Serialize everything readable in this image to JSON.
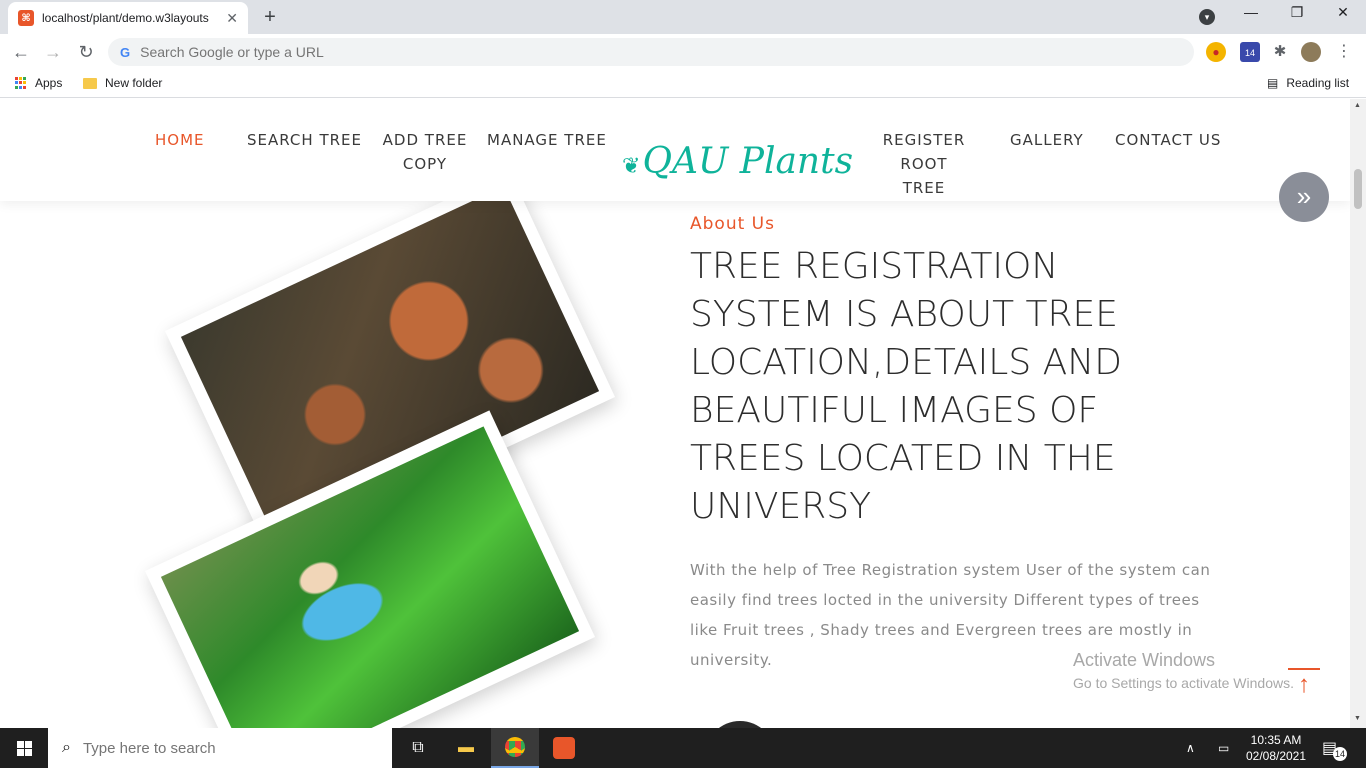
{
  "browser": {
    "tab_title": "localhost/plant/demo.w3layouts",
    "tab_close": "✕",
    "new_tab": "+",
    "omnibox_placeholder": "Search Google or type a URL",
    "google_letter": "G",
    "extension_badge": "14",
    "bookmarks": [
      {
        "label": "Apps"
      },
      {
        "label": "New folder"
      }
    ],
    "reading_list": "Reading list",
    "window_controls": {
      "minimize": "—",
      "restore": "❐",
      "close": "✕"
    },
    "nav": {
      "back": "←",
      "forward": "→",
      "reload": "↻"
    },
    "menu_dots": "⋮"
  },
  "site": {
    "menu": [
      {
        "label": "HOME",
        "active": true
      },
      {
        "label": "SEARCH TREE"
      },
      {
        "label": "ADD TREE COPY"
      },
      {
        "label": "MANAGE TREE"
      },
      {
        "label": "REGISTER ROOT TREE"
      },
      {
        "label": "GALLERY"
      },
      {
        "label": "CONTACT US"
      }
    ],
    "logo": "QAU Plants",
    "logo_leaf": "❦",
    "next_icon": "»",
    "about": {
      "label": "About Us",
      "title": "TREE REGISTRATION SYSTEM IS ABOUT TREE LOCATION,DETAILS AND BEAUTIFUL IMAGES OF TREES LOCATED IN THE UNIVERSY",
      "text": "With the help of Tree Registration system User of the system can easily find trees locted in the university Different types of trees like Fruit trees , Shady trees and Evergreen trees are mostly in university."
    },
    "to_top_icon": "↑"
  },
  "watermark": {
    "line1": "Activate Windows",
    "line2": "Go to Settings to activate Windows."
  },
  "taskbar": {
    "search_placeholder": "Type here to search",
    "time": "10:35 AM",
    "date": "02/08/2021",
    "notification_count": "14"
  },
  "colors": {
    "accent": "#e8562a",
    "logo": "#0fb39a",
    "text_dark": "#2d2d2d",
    "text_muted": "#8a8a8a"
  }
}
